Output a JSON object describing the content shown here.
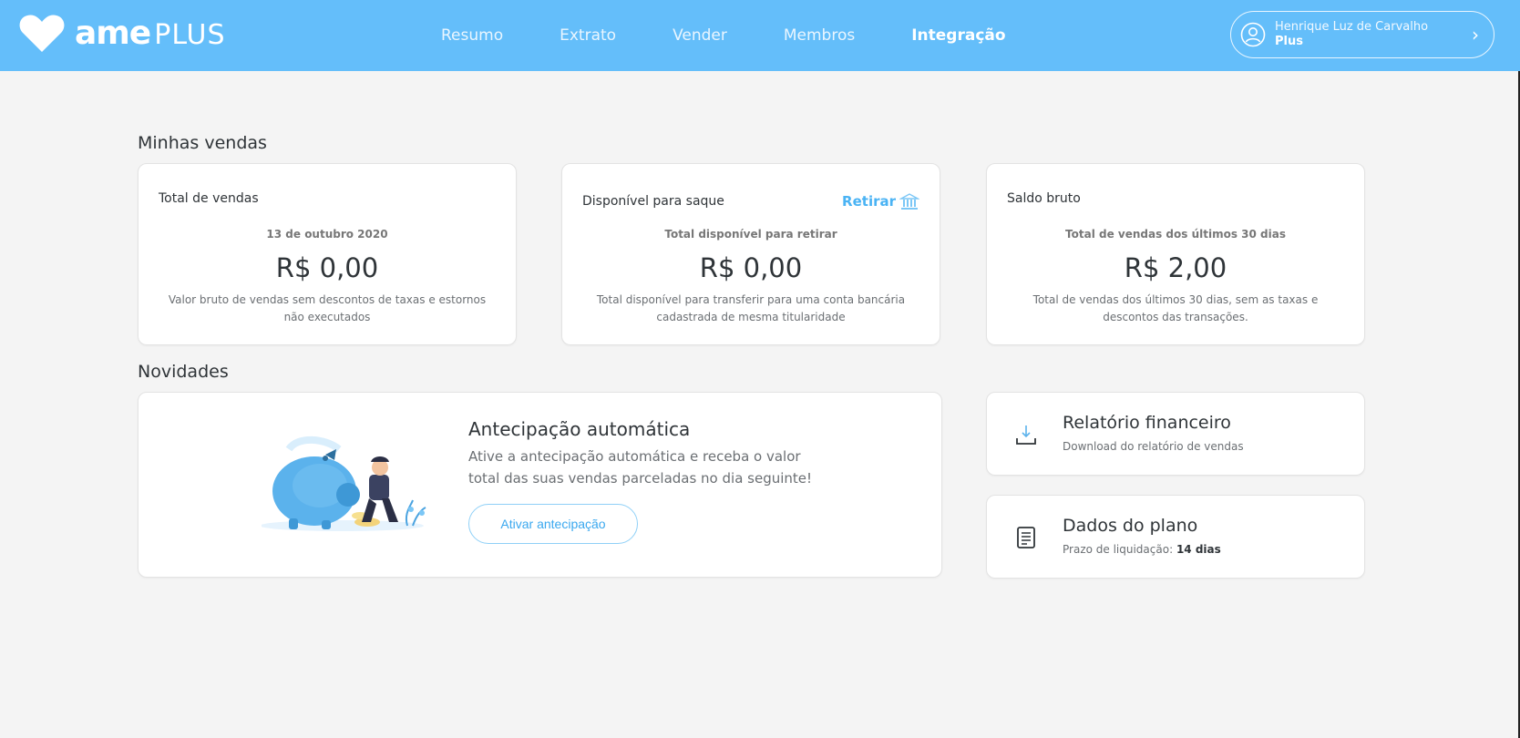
{
  "brand": {
    "name": "ame",
    "suffix": "PLUS",
    "color": "#64befa"
  },
  "nav": [
    {
      "label": "Resumo",
      "active": false
    },
    {
      "label": "Extrato",
      "active": false
    },
    {
      "label": "Vender",
      "active": false
    },
    {
      "label": "Membros",
      "active": false
    },
    {
      "label": "Integração",
      "active": true
    }
  ],
  "user": {
    "name": "Henrique Luz de Carvalho",
    "plan": "Plus",
    "icon": "user-circle-icon",
    "chevron": "›"
  },
  "sales": {
    "title": "Minhas vendas",
    "cards": [
      {
        "label": "Total de vendas",
        "sub": "13 de outubro 2020",
        "value": "R$ 0,00",
        "desc": "Valor bruto de vendas sem descontos de taxas e estornos não executados"
      },
      {
        "label": "Disponível para saque",
        "action": "Retirar",
        "action_icon": "bank-icon",
        "sub": "Total disponível para retirar",
        "value": "R$ 0,00",
        "desc": "Total disponível para transferir para uma conta bancária cadastrada de mesma titularidade"
      },
      {
        "label": "Saldo bruto",
        "sub": "Total de vendas dos últimos 30 dias",
        "value": "R$ 2,00",
        "desc": "Total de vendas dos últimos 30 dias, sem as taxas e descontos das transações."
      }
    ]
  },
  "news": {
    "title": "Novidades",
    "promo": {
      "title": "Antecipação automática",
      "text": "Ative a antecipação automática e receba o valor total das suas vendas parceladas no dia seguinte!",
      "button": "Ativar antecipação",
      "illustration": "piggy-bank-illustration"
    },
    "report": {
      "title": "Relatório financeiro",
      "sub": "Download do relatório de vendas",
      "icon": "download-icon"
    },
    "plan": {
      "title": "Dados do plano",
      "sub_label": "Prazo de liquidação:",
      "sub_value": "14 dias",
      "icon": "document-icon"
    }
  },
  "colors": {
    "accent": "#4ab3f4",
    "background": "#f4f4f4",
    "text": "#2f3438"
  }
}
